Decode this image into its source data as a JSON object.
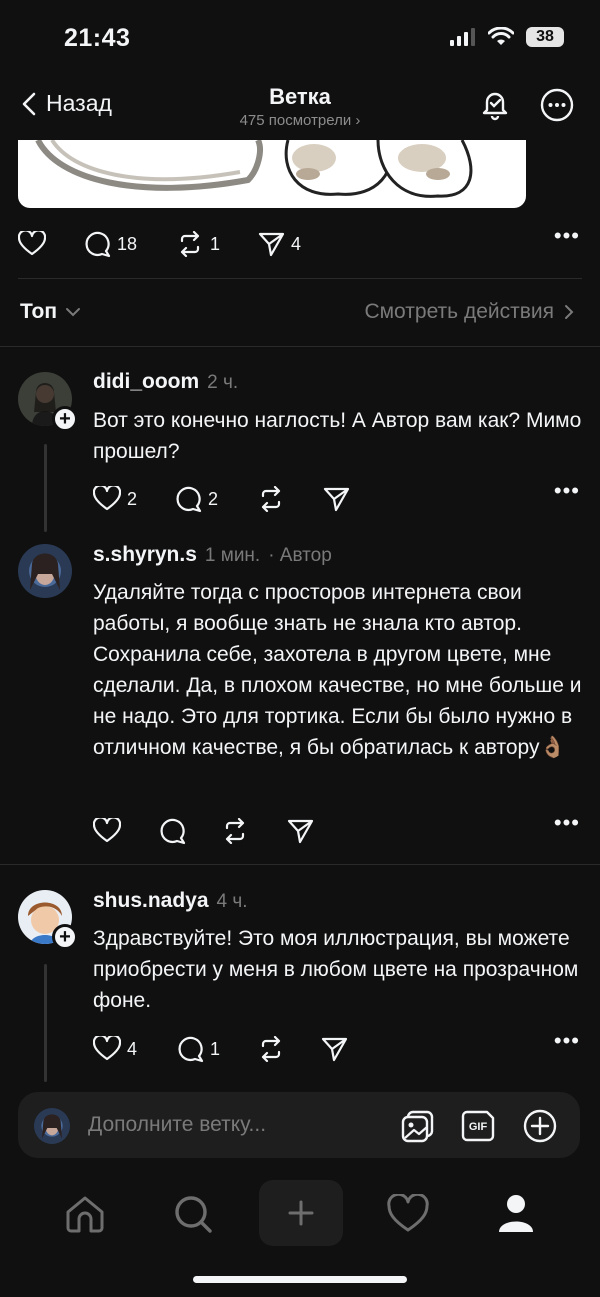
{
  "status_bar": {
    "time": "21:43",
    "battery": "38"
  },
  "header": {
    "back_label": "Назад",
    "title": "Ветка",
    "views": "475 посмотрели"
  },
  "main_post": {
    "likes": "",
    "replies": "18",
    "reposts": "1",
    "shares": "4"
  },
  "sort": {
    "label": "Топ",
    "activity_link": "Смотреть действия"
  },
  "replies": [
    {
      "username": "didi_ooom",
      "time": "2 ч.",
      "author_tag": "",
      "text": "Вот это конечно наглость! А Автор вам как? Мимо прошел?",
      "likes": "2",
      "replies": "2",
      "reposts": "",
      "shares": ""
    },
    {
      "username": "s.shyryn.s",
      "time": "1 мин.",
      "author_tag": "· Автор",
      "text": "Удаляйте тогда с просторов интернета свои работы, я вообще знать не знала кто автор. Сохранила себе, захотела в другом цвете, мне сделали. Да, в плохом качестве, но мне больше и не надо. Это для тортика. Если бы было нужно в отличном качестве, я бы обратилась к автору👌🏽",
      "likes": "",
      "replies": "",
      "reposts": "",
      "shares": ""
    },
    {
      "username": "shus.nadya",
      "time": "4 ч.",
      "author_tag": "",
      "text": "Здравствуйте! Это моя иллюстрация, вы можете приобрести у меня в любом цвете на прозрачном фоне.",
      "likes": "4",
      "replies": "1",
      "reposts": "",
      "shares": ""
    }
  ],
  "composer": {
    "placeholder": "Дополните ветку..."
  },
  "colors": {
    "background": "#101010",
    "text": "#f3f5f7",
    "muted": "#7a7a7a",
    "surface": "#1e1e1e"
  }
}
